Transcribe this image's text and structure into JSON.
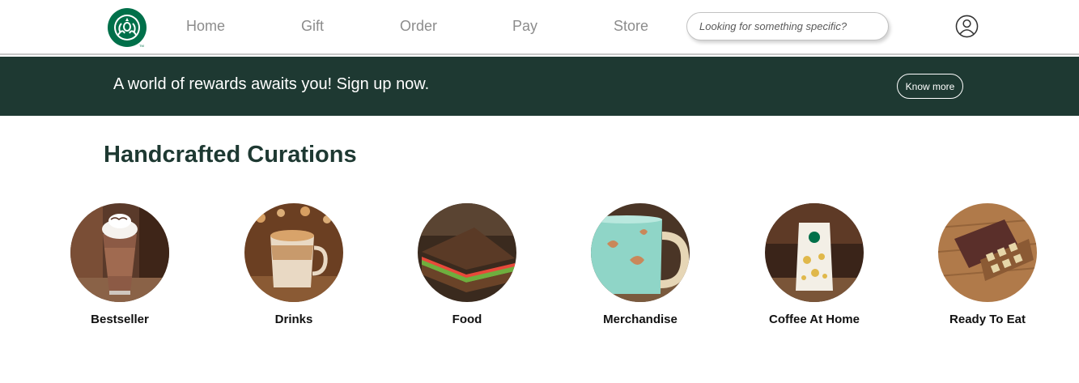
{
  "brand": {
    "logo_icon": "starbucks-siren-logo",
    "color": "#00704a",
    "dark_green": "#1e3932"
  },
  "nav": {
    "links": [
      "Home",
      "Gift",
      "Order",
      "Pay",
      "Store"
    ],
    "search_placeholder": "Looking for something specific?",
    "profile_icon": "user-circle-icon"
  },
  "banner": {
    "text": "A world of rewards awaits you! Sign up now.",
    "button_label": "Know more"
  },
  "section": {
    "title": "Handcrafted Curations",
    "categories": [
      {
        "label": "Bestseller",
        "image": "frappuccino-image"
      },
      {
        "label": "Drinks",
        "image": "latte-mug-image"
      },
      {
        "label": "Food",
        "image": "sandwich-image"
      },
      {
        "label": "Merchandise",
        "image": "mug-image"
      },
      {
        "label": "Coffee At Home",
        "image": "coffee-bag-image"
      },
      {
        "label": "Ready To Eat",
        "image": "chocolate-box-image"
      }
    ]
  }
}
